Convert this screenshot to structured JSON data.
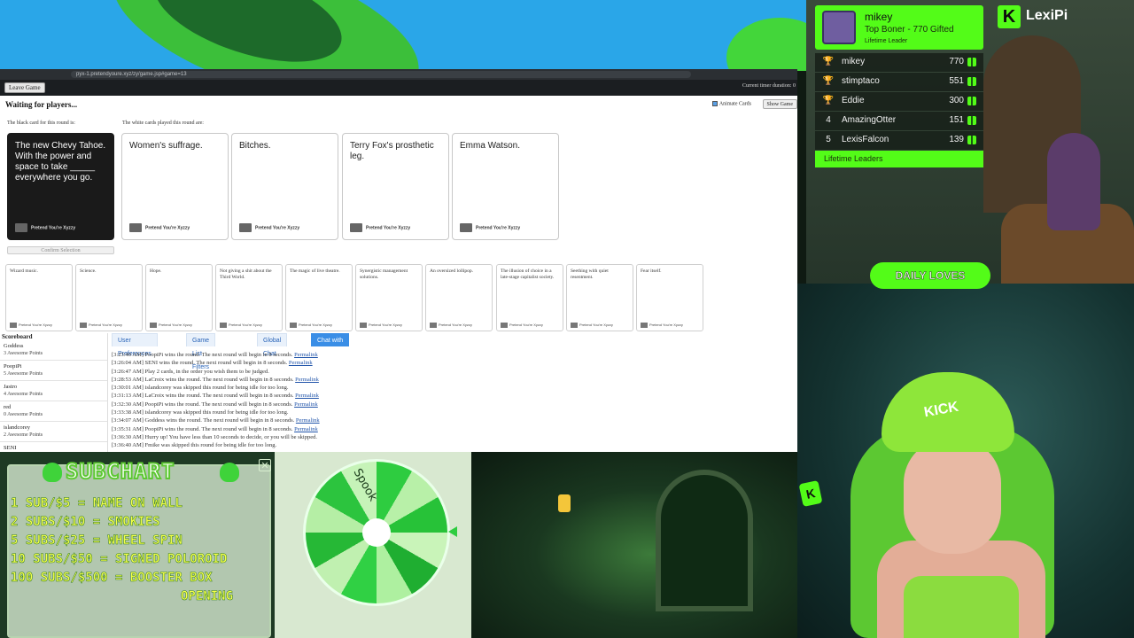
{
  "browser": {
    "url": "pyx-1.pretendyoure.xyz/zy/game.jsp#game=13",
    "leave_game_label": "Leave Game",
    "timer_text": "Current timer duration: 0",
    "waiting_text": "Waiting for players...",
    "animate_cards_label": "Animate Cards",
    "show_game_label": "Show Game",
    "black_card_label": "The black card for this round is:",
    "white_cards_label": "The white cards played this round are:",
    "confirm_label": "Confirm Selection"
  },
  "black_card": {
    "text": "The new Chevy Tahoe. With the power and space to take _____ everywhere you go.",
    "brand": "Pretend You're Xyzzy"
  },
  "played_cards": [
    {
      "text": "Women's suffrage.",
      "brand": "Pretend You're Xyzzy"
    },
    {
      "text": "Bitches.",
      "brand": "Pretend You're Xyzzy"
    },
    {
      "text": "Terry Fox's prosthetic leg.",
      "brand": "Pretend You're Xyzzy"
    },
    {
      "text": "Emma Watson.",
      "brand": "Pretend You're Xyzzy"
    }
  ],
  "hand_cards": [
    {
      "text": "Wizard music.",
      "brand": "Pretend You're Xyzzy"
    },
    {
      "text": "Science.",
      "brand": "Pretend You're Xyzzy"
    },
    {
      "text": "Hope.",
      "brand": "Pretend You're Xyzzy"
    },
    {
      "text": "Not giving a shit about the Third World.",
      "brand": "Pretend You're Xyzzy"
    },
    {
      "text": "The magic of live theatre.",
      "brand": "Pretend You're Xyzzy"
    },
    {
      "text": "Synergistic management solutions.",
      "brand": "Pretend You're Xyzzy"
    },
    {
      "text": "An oversized lollipop.",
      "brand": "Pretend You're Xyzzy"
    },
    {
      "text": "The illusion of choice in a late-stage capitalist society.",
      "brand": "Pretend You're Xyzzy"
    },
    {
      "text": "Seething with quiet resentment.",
      "brand": "Pretend You're Xyzzy"
    },
    {
      "text": "Fear itself.",
      "brand": "Pretend You're Xyzzy"
    }
  ],
  "scoreboard": {
    "title": "Scoreboard",
    "rows": [
      {
        "name": "Goddess",
        "points": "3 Awesome Points"
      },
      {
        "name": "PoopiPi",
        "points": "5 Awesome Points"
      },
      {
        "name": "Jastro",
        "points": "4 Awesome Points"
      },
      {
        "name": "red",
        "points": "0 Awesome Points"
      },
      {
        "name": "islandcorey",
        "points": "2 Awesome Points"
      }
    ],
    "partial_row": "SENI"
  },
  "chat_tabs": [
    "User Preferences",
    "Game List Filters",
    "Global Chat",
    "Chat with game members"
  ],
  "chat_log": [
    {
      "text": "[3:23:40 AM] PoopiPi wins the round. The next round will begin in 8 seconds.",
      "link": "Permalink"
    },
    {
      "text": "[3:26:04 AM] SENI wins the round. The next round will begin in 8 seconds.",
      "link": "Permalink"
    },
    {
      "text": "[3:26:47 AM] Play 2 cards, in the order you wish them to be judged.",
      "link": ""
    },
    {
      "text": "[3:28:53 AM] LaCroix wins the round. The next round will begin in 8 seconds.",
      "link": "Permalink"
    },
    {
      "text": "[3:30:01 AM] islandcorey was skipped this round for being idle for too long.",
      "link": ""
    },
    {
      "text": "[3:31:13 AM] LaCroix wins the round. The next round will begin in 8 seconds.",
      "link": "Permalink"
    },
    {
      "text": "[3:32:30 AM] PoopiPi wins the round. The next round will begin in 8 seconds.",
      "link": "Permalink"
    },
    {
      "text": "[3:33:38 AM] islandcorey was skipped this round for being idle for too long.",
      "link": ""
    },
    {
      "text": "[3:34:07 AM] Goddess wins the round. The next round will begin in 8 seconds.",
      "link": "Permalink"
    },
    {
      "text": "[3:35:31 AM] PoopiPi wins the round. The next round will begin in 8 seconds.",
      "link": "Permalink"
    },
    {
      "text": "[3:36:30 AM] Hurry up! You have less than 10 seconds to decide, or you will be skipped.",
      "link": ""
    },
    {
      "text": "[3:36:40 AM] Fmike was skipped this round for being idle for too long.",
      "link": ""
    }
  ],
  "leaderboard": {
    "top_name": "mikey",
    "top_subtitle": "Top Boner - 770 Gifted",
    "top_footer": "Lifetime Leader",
    "rows": [
      {
        "rank": "",
        "name": "mikey",
        "value": "770"
      },
      {
        "rank": "",
        "name": "stimptaco",
        "value": "551"
      },
      {
        "rank": "",
        "name": "Eddie",
        "value": "300"
      },
      {
        "rank": "4",
        "name": "AmazingOtter",
        "value": "151"
      },
      {
        "rank": "5",
        "name": "LexisFalcon",
        "value": "139"
      }
    ],
    "footer": "Lifetime Leaders"
  },
  "kick": {
    "logo_letter": "K",
    "channel": "LexiPi",
    "hat_text": "KICK"
  },
  "daily_loves": "DAILY LOVES",
  "subchart": {
    "title": "SUBCHART",
    "lines": [
      "1 SUB/$5 = NAME ON WALL",
      "2 SUBS/$10 = SMOKIES",
      "5 SUBS/$25 = WHEEL SPIN",
      "10 SUBS/$50 = SIGNED POLOROID",
      "100 SUBS/$500 = BOOSTER BOX",
      "OPENING"
    ]
  },
  "wheel": {
    "label": "Spook"
  },
  "colors": {
    "kick_green": "#53fc18",
    "chat_tab_active": "#3a8ee6",
    "subchart_text": "#f5ff4a"
  }
}
